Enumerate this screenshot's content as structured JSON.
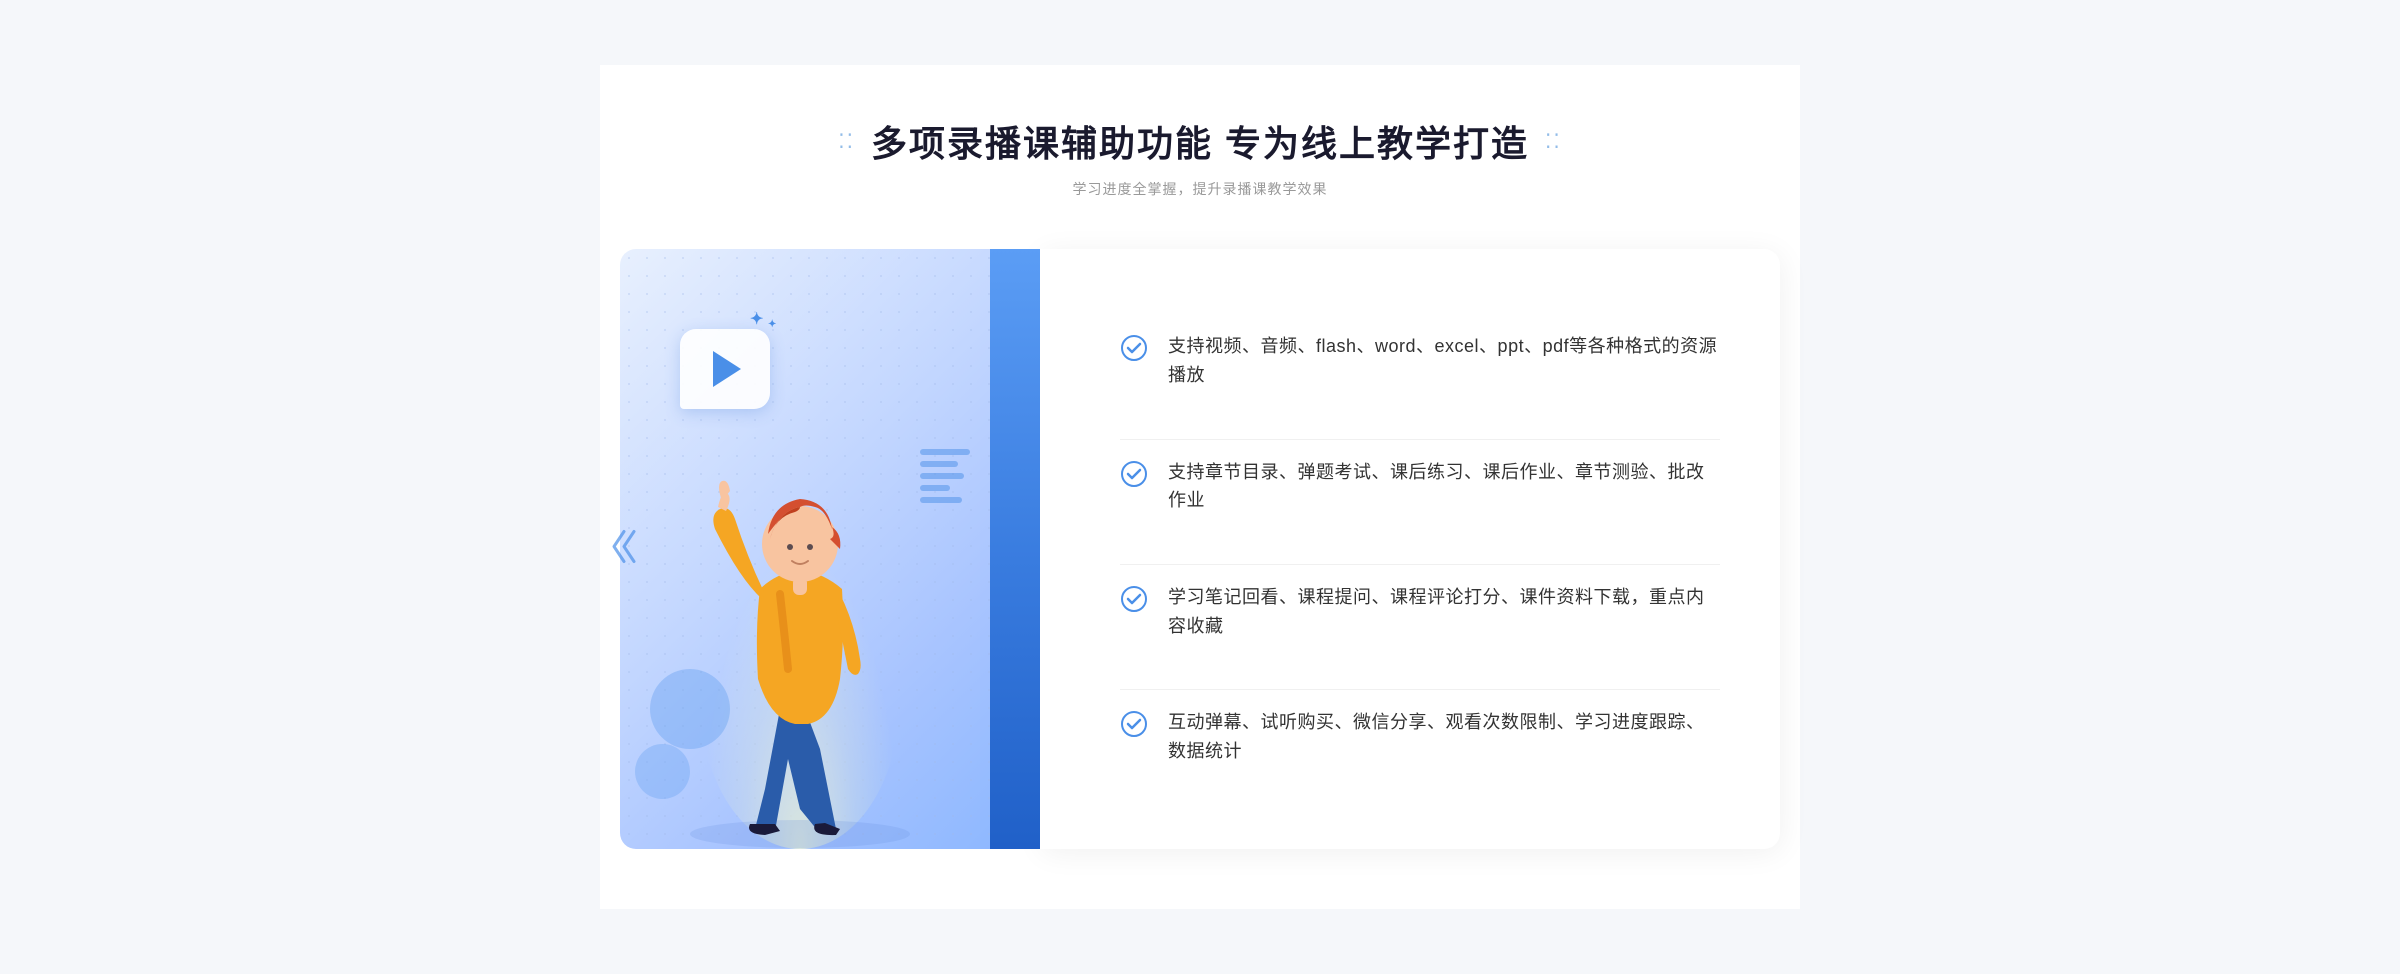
{
  "header": {
    "title": "多项录播课辅助功能 专为线上教学打造",
    "subtitle": "学习进度全掌握，提升录播课教学效果",
    "dots_left": "⁚⁚",
    "dots_right": "⁚⁚"
  },
  "features": [
    {
      "id": 1,
      "text": "支持视频、音频、flash、word、excel、ppt、pdf等各种格式的资源播放"
    },
    {
      "id": 2,
      "text": "支持章节目录、弹题考试、课后练习、课后作业、章节测验、批改作业"
    },
    {
      "id": 3,
      "text": "学习笔记回看、课程提问、课程评论打分、课件资料下载，重点内容收藏"
    },
    {
      "id": 4,
      "text": "互动弹幕、试听购买、微信分享、观看次数限制、学习进度跟踪、数据统计"
    }
  ]
}
